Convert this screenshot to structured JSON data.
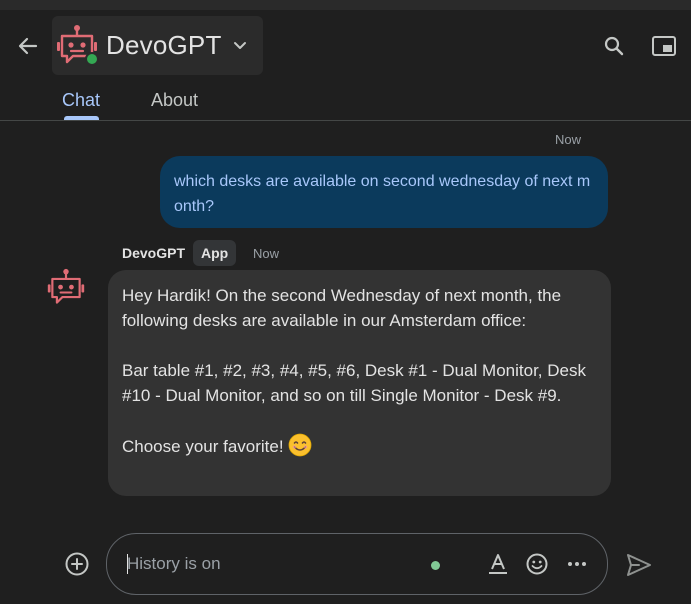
{
  "header": {
    "app_name": "DevoGPT",
    "tabs": [
      {
        "label": "Chat",
        "active": true
      },
      {
        "label": "About",
        "active": false
      }
    ],
    "accent_color": "#a8c7fa",
    "bot_color": "#e06c75",
    "status_color": "#34a853",
    "icons": [
      "back-arrow-icon",
      "bot-icon",
      "chevron-down-icon",
      "search-icon",
      "picture-in-picture-icon"
    ]
  },
  "messages": [
    {
      "role": "user",
      "timestamp": "Now",
      "text": "which desks are available on second wednesday of next month?",
      "bubble_color": "#0b3a5c"
    },
    {
      "role": "bot",
      "sender": "DevoGPT",
      "badge": "App",
      "timestamp": "Now",
      "paragraphs": [
        "Hey Hardik! On the second Wednesday of next month, the following desks are available in our Amsterdam office:",
        "Bar table #1, #2, #3, #4, #5, #6, Desk #1 - Dual Monitor, Desk #10 - Dual Monitor, and so on till Single Monitor - Desk #9.",
        "Choose your favorite!"
      ],
      "emoji": "smiling-face-icon",
      "bubble_color": "#333333"
    }
  ],
  "composer": {
    "placeholder": "History is on",
    "value": "",
    "history_dot_color": "#81c995",
    "icons": [
      "add-circle-icon",
      "text-format-icon",
      "emoji-icon",
      "more-horiz-icon",
      "send-icon"
    ]
  }
}
